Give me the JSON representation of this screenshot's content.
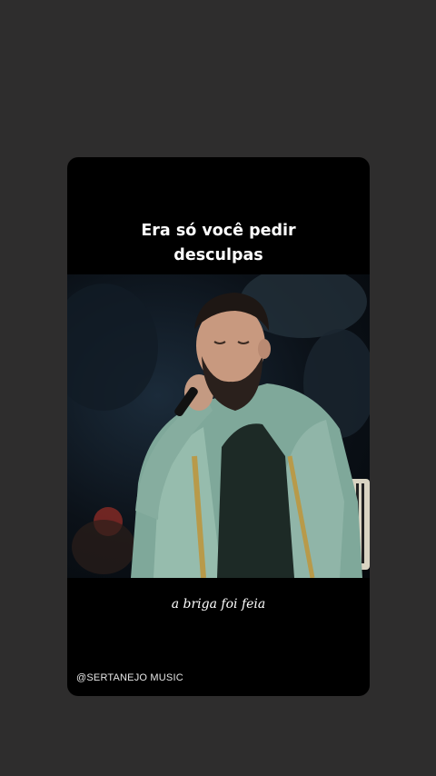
{
  "story": {
    "caption_top_line1": "Era só você pedir",
    "caption_top_line2": "desculpas",
    "caption_bottom": "a briga foi feia",
    "watermark": "@SERTANEJO MUSIC"
  },
  "colors": {
    "background": "#2e2d2d",
    "card": "#000000",
    "text": "#ffffff"
  }
}
